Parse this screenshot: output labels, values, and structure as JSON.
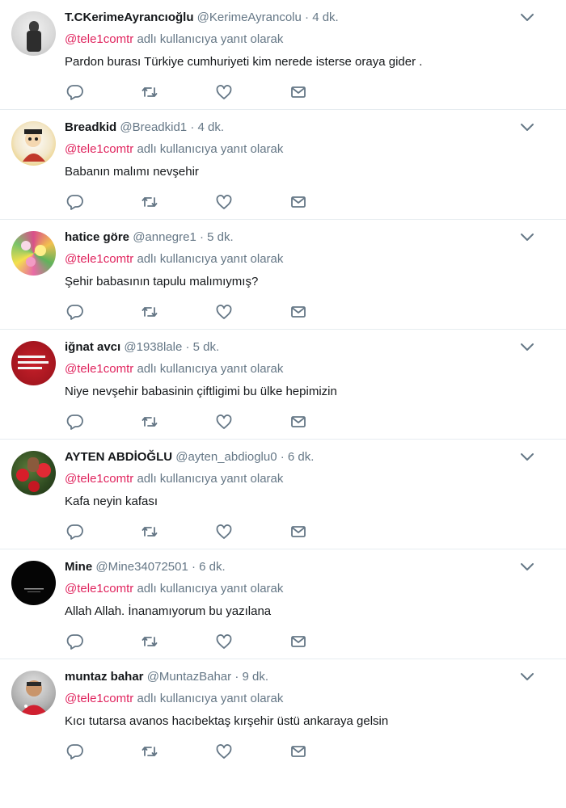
{
  "tweets": [
    {
      "name": "T.CKerimeAyrancıoğlu",
      "handle": "@KerimeAyrancolu",
      "dot": "·",
      "time": "4 dk.",
      "mention": "@tele1comtr",
      "reply_suffix": "adlı kullanıcıya yanıt olarak",
      "text": "Pardon burası Türkiye cumhuriyeti kim nerede isterse oraya gider ."
    },
    {
      "name": "Breadkid",
      "handle": "@Breadkid1",
      "dot": "·",
      "time": "4 dk.",
      "mention": "@tele1comtr",
      "reply_suffix": "adlı kullanıcıya yanıt olarak",
      "text": "Babanın malımı nevşehir"
    },
    {
      "name": "hatice göre",
      "handle": "@annegre1",
      "dot": "·",
      "time": "5 dk.",
      "mention": "@tele1comtr",
      "reply_suffix": "adlı kullanıcıya yanıt olarak",
      "text": "Şehir babasının tapulu malımıymış?"
    },
    {
      "name": "iğnat avcı",
      "handle": "@1938lale",
      "dot": "·",
      "time": "5 dk.",
      "mention": "@tele1comtr",
      "reply_suffix": "adlı kullanıcıya yanıt olarak",
      "text": "Niye nevşehir babasinin çiftligimi bu ülke hepimizin"
    },
    {
      "name": "AYTEN ABDİOĞLU",
      "handle": "@ayten_abdioglu0",
      "dot": "·",
      "time": "6 dk.",
      "mention": "@tele1comtr",
      "reply_suffix": "adlı kullanıcıya yanıt olarak",
      "text": "Kafa neyin kafası"
    },
    {
      "name": "Mine",
      "handle": "@Mine34072501",
      "dot": "·",
      "time": "6 dk.",
      "mention": "@tele1comtr",
      "reply_suffix": "adlı kullanıcıya yanıt olarak",
      "text": "Allah Allah. İnanamıyorum bu yazılana"
    },
    {
      "name": "muntaz bahar",
      "handle": "@MuntazBahar",
      "dot": "·",
      "time": "9 dk.",
      "mention": "@tele1comtr",
      "reply_suffix": "adlı kullanıcıya yanıt olarak",
      "text": "Kıcı tutarsa avanos hacıbektaş kırşehir üstü ankaraya gelsin"
    }
  ],
  "icons": {
    "reply": "reply-icon",
    "retweet": "retweet-icon",
    "like": "like-icon",
    "dm": "direct-message-icon",
    "caret": "chevron-down-icon"
  },
  "colors": {
    "mention": "#e0245e",
    "secondary_text": "#657786",
    "primary_text": "#14171a",
    "divider": "#e6ecf0"
  }
}
